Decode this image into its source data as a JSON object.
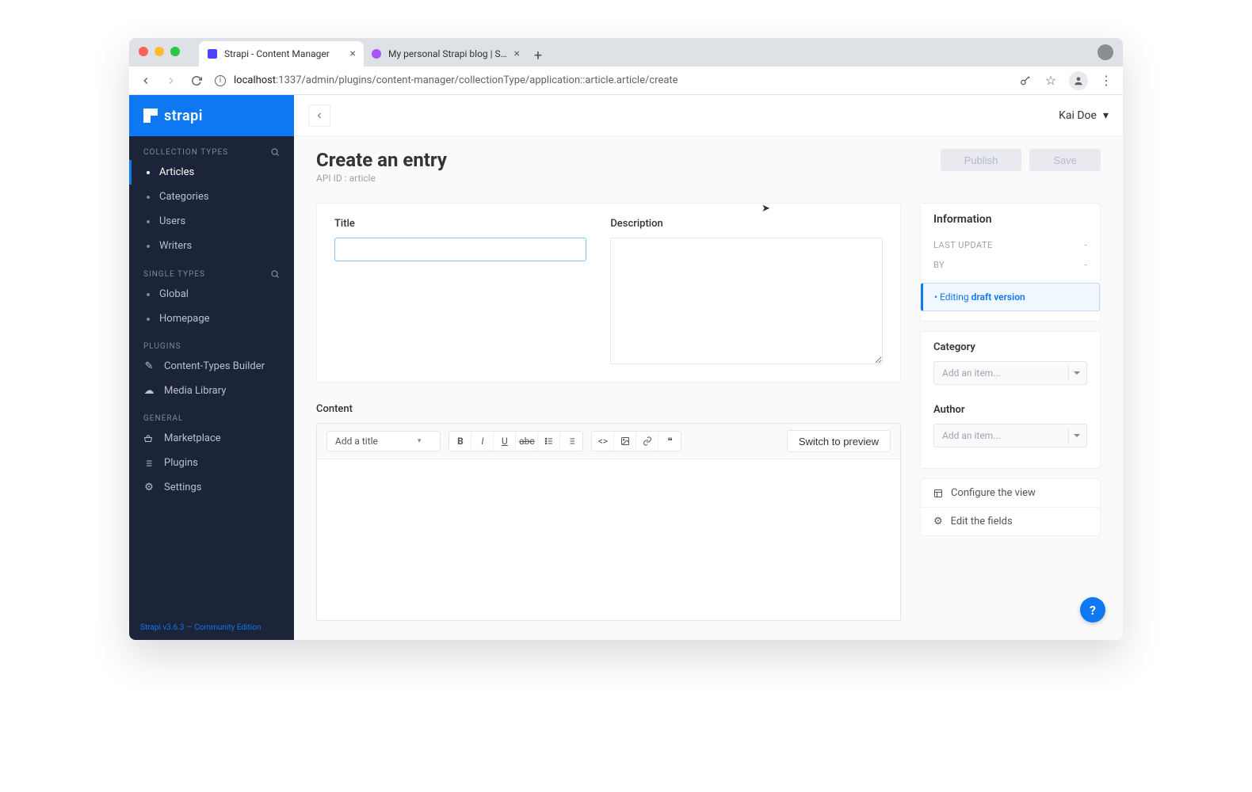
{
  "browser": {
    "tabs": [
      {
        "title": "Strapi - Content Manager"
      },
      {
        "title": "My personal Strapi blog | Strap"
      }
    ],
    "url_host": "localhost",
    "url_path": ":1337/admin/plugins/content-manager/collectionType/application::article.article/create"
  },
  "logo": "strapi",
  "sidebar": {
    "collection_label": "COLLECTION TYPES",
    "collection_items": [
      "Articles",
      "Categories",
      "Users",
      "Writers"
    ],
    "single_label": "SINGLE TYPES",
    "single_items": [
      "Global",
      "Homepage"
    ],
    "plugins_label": "PLUGINS",
    "plugins_items": [
      "Content-Types Builder",
      "Media Library"
    ],
    "general_label": "GENERAL",
    "general_items": [
      "Marketplace",
      "Plugins",
      "Settings"
    ],
    "footer": "Strapi v3.6.3 — Community Edition"
  },
  "topbar": {
    "user": "Kai Doe"
  },
  "header": {
    "title": "Create an entry",
    "api_id": "API ID : article",
    "publish": "Publish",
    "save": "Save"
  },
  "form": {
    "title_label": "Title",
    "title_value": "",
    "desc_label": "Description",
    "desc_value": "",
    "content_label": "Content",
    "title_select": "Add a title",
    "preview": "Switch to preview"
  },
  "info_panel": {
    "heading": "Information",
    "last_update_label": "LAST UPDATE",
    "last_update_value": "-",
    "by_label": "BY",
    "by_value": "-",
    "editing": "Editing",
    "draft": "draft version"
  },
  "relations": {
    "category_label": "Category",
    "author_label": "Author",
    "placeholder": "Add an item..."
  },
  "links": {
    "configure": "Configure the view",
    "edit_fields": "Edit the fields"
  },
  "help": "?"
}
